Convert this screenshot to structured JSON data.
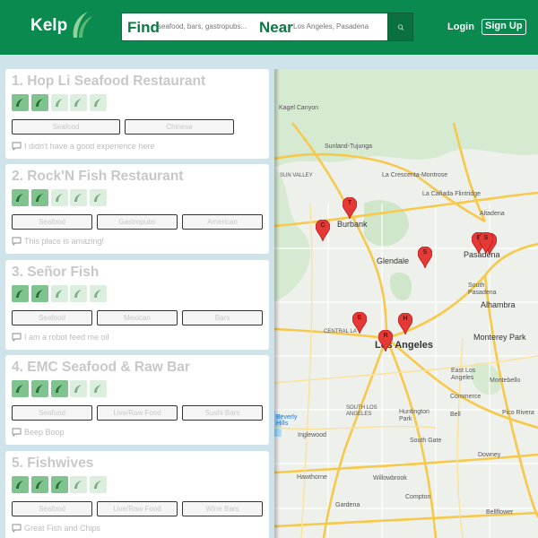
{
  "header": {
    "logo": "Kelp",
    "find_label": "Find",
    "find_placeholder": "seafood, bars, gastropubs...",
    "near_label": "Near",
    "near_placeholder": "Los Angeles, Pasadena",
    "login": "Login",
    "signup": "Sign Up"
  },
  "colors": {
    "brand": "#0a8a4e",
    "star_on": "#7fc48e",
    "star_off": "#dcefdf",
    "pin": "#e53935"
  },
  "results": [
    {
      "title": "1. Hop Li Seafood Restaurant",
      "rating": 2,
      "tags": [
        "Seafood",
        "Chinese"
      ],
      "review": "I didn't have a good experience here"
    },
    {
      "title": "2. Rock'N Fish Restaurant",
      "rating": 2,
      "tags": [
        "Seafood",
        "Gastropubs",
        "American"
      ],
      "review": "This place is amazing!"
    },
    {
      "title": "3. Señor Fish",
      "rating": 2,
      "tags": [
        "Seafood",
        "Mexican",
        "Bars"
      ],
      "review": "I am a robot feed me oil"
    },
    {
      "title": "4. EMC Seafood & Raw Bar",
      "rating": 3,
      "tags": [
        "Seafood",
        "Live/Raw Food",
        "Sushi Bars"
      ],
      "review": "Beep Boop"
    },
    {
      "title": "5. Fishwives",
      "rating": 3,
      "tags": [
        "Seafood",
        "Live/Raw Food",
        "Wine Bars"
      ],
      "review": "Great Fish and Chips"
    }
  ],
  "map": {
    "cities": [
      "Kagel Canyon",
      "Sunland-Tujunga",
      "La Crescenta-Montrose",
      "La Cañada Flintridge",
      "Burbank",
      "Glendale",
      "Altadena",
      "Pasadena",
      "South Pasadena",
      "Alhambra",
      "Los Angeles",
      "Monterey Park",
      "East Los Angeles",
      "Montebello",
      "Commerce",
      "Huntington Park",
      "Pico Rivera",
      "South Gate",
      "Inglewood",
      "Downey",
      "Hawthorne",
      "Willowbrook",
      "Compton",
      "Gardena",
      "Bellflower",
      "CENTRAL LA",
      "SOUTH LOS ANGELES",
      "SUN VALLEY",
      "Beverly Hills",
      "Bell"
    ],
    "pins": [
      "T",
      "C",
      "S",
      "E",
      "S",
      "S",
      "E",
      "H",
      "R"
    ]
  }
}
